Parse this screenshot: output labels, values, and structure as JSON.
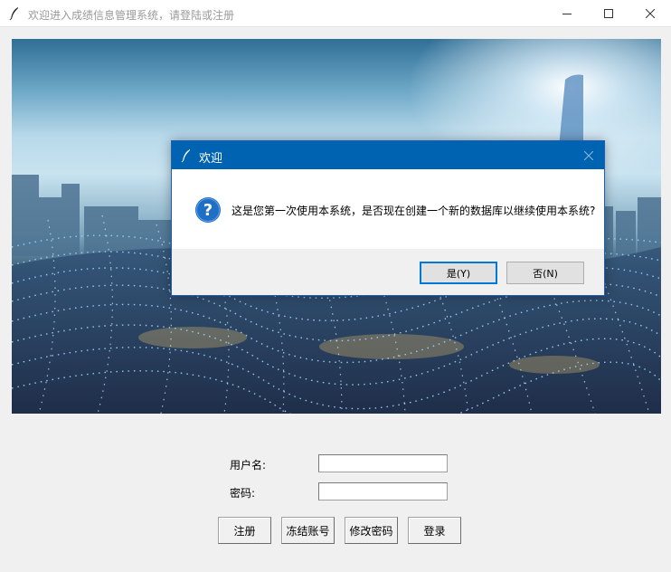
{
  "window": {
    "title": "欢迎进入成绩信息管理系统，请登陆或注册",
    "title_icon": "feather-icon",
    "controls": [
      "minimize-icon",
      "maximize-icon",
      "close-icon"
    ]
  },
  "background_image": {
    "description_icon": "city-data-network-image"
  },
  "form": {
    "username_label": "用户名:",
    "username_value": "",
    "password_label": "密码:",
    "password_value": ""
  },
  "buttons": {
    "register": "注册",
    "freeze": "冻结账号",
    "change_password": "修改密码",
    "login": "登录"
  },
  "dialog": {
    "title": "欢迎",
    "icon": "question-icon",
    "message": "这是您第一次使用本系统，是否现在创建一个新的数据库以继续使用本系统?",
    "yes_label": "是(Y)",
    "no_label": "否(N)"
  },
  "colors": {
    "dialog_titlebar": "#0063b1",
    "question_icon": "#1f6fc5",
    "default_button_border": "#0078d7"
  }
}
